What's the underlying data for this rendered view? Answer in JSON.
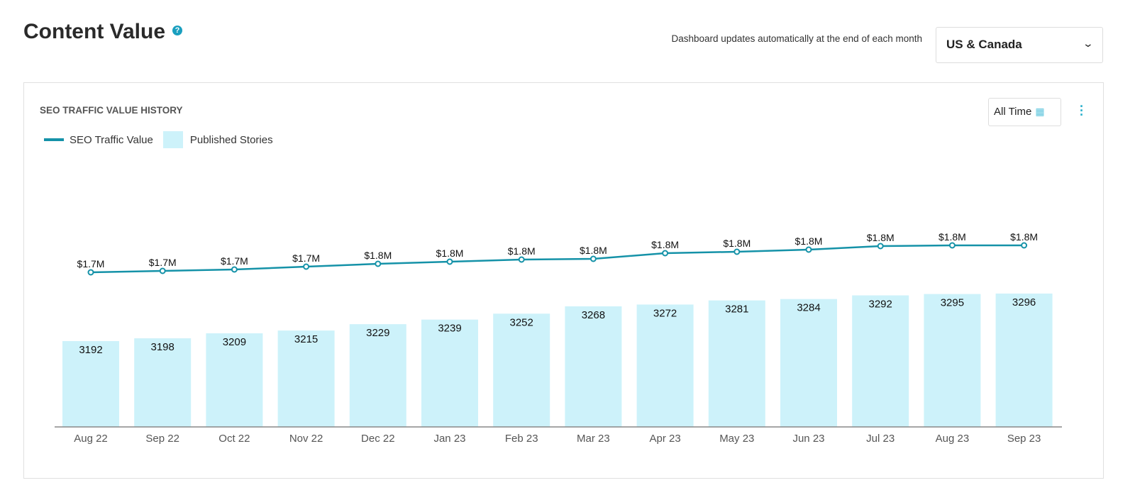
{
  "header": {
    "title": "Content Value",
    "help_icon": "question-circle-icon",
    "note": "Dashboard updates automatically at the end of each month",
    "region_select": "US & Canada"
  },
  "card": {
    "title": "SEO TRAFFIC VALUE HISTORY",
    "date_range": "All Time",
    "calendar_icon": "calendar-icon",
    "menu_icon": "kebab-menu-icon"
  },
  "chart_data": {
    "type": "bar+line",
    "categories": [
      "Aug 22",
      "Sep 22",
      "Oct 22",
      "Nov 22",
      "Dec 22",
      "Jan 23",
      "Feb 23",
      "Mar 23",
      "Apr 23",
      "May 23",
      "Jun 23",
      "Jul 23",
      "Aug 23",
      "Sep 23"
    ],
    "series": [
      {
        "name": "Published Stories",
        "type": "bar",
        "color": "#cdf2fa",
        "values": [
          3192,
          3198,
          3209,
          3215,
          3229,
          3239,
          3252,
          3268,
          3272,
          3281,
          3284,
          3292,
          3295,
          3296
        ]
      },
      {
        "name": "SEO Traffic Value",
        "type": "line",
        "color": "#1592a8",
        "unit": "$M",
        "values": [
          1.725,
          1.73,
          1.735,
          1.745,
          1.755,
          1.7625,
          1.77,
          1.7725,
          1.7925,
          1.7975,
          1.805,
          1.8175,
          1.82,
          1.82
        ],
        "labels": [
          "$1.7M",
          "$1.7M",
          "$1.7M",
          "$1.7M",
          "$1.8M",
          "$1.8M",
          "$1.8M",
          "$1.8M",
          "$1.8M",
          "$1.8M",
          "$1.8M",
          "$1.8M",
          "$1.8M",
          "$1.8M"
        ]
      }
    ],
    "legend": "top-left",
    "grid": false
  }
}
